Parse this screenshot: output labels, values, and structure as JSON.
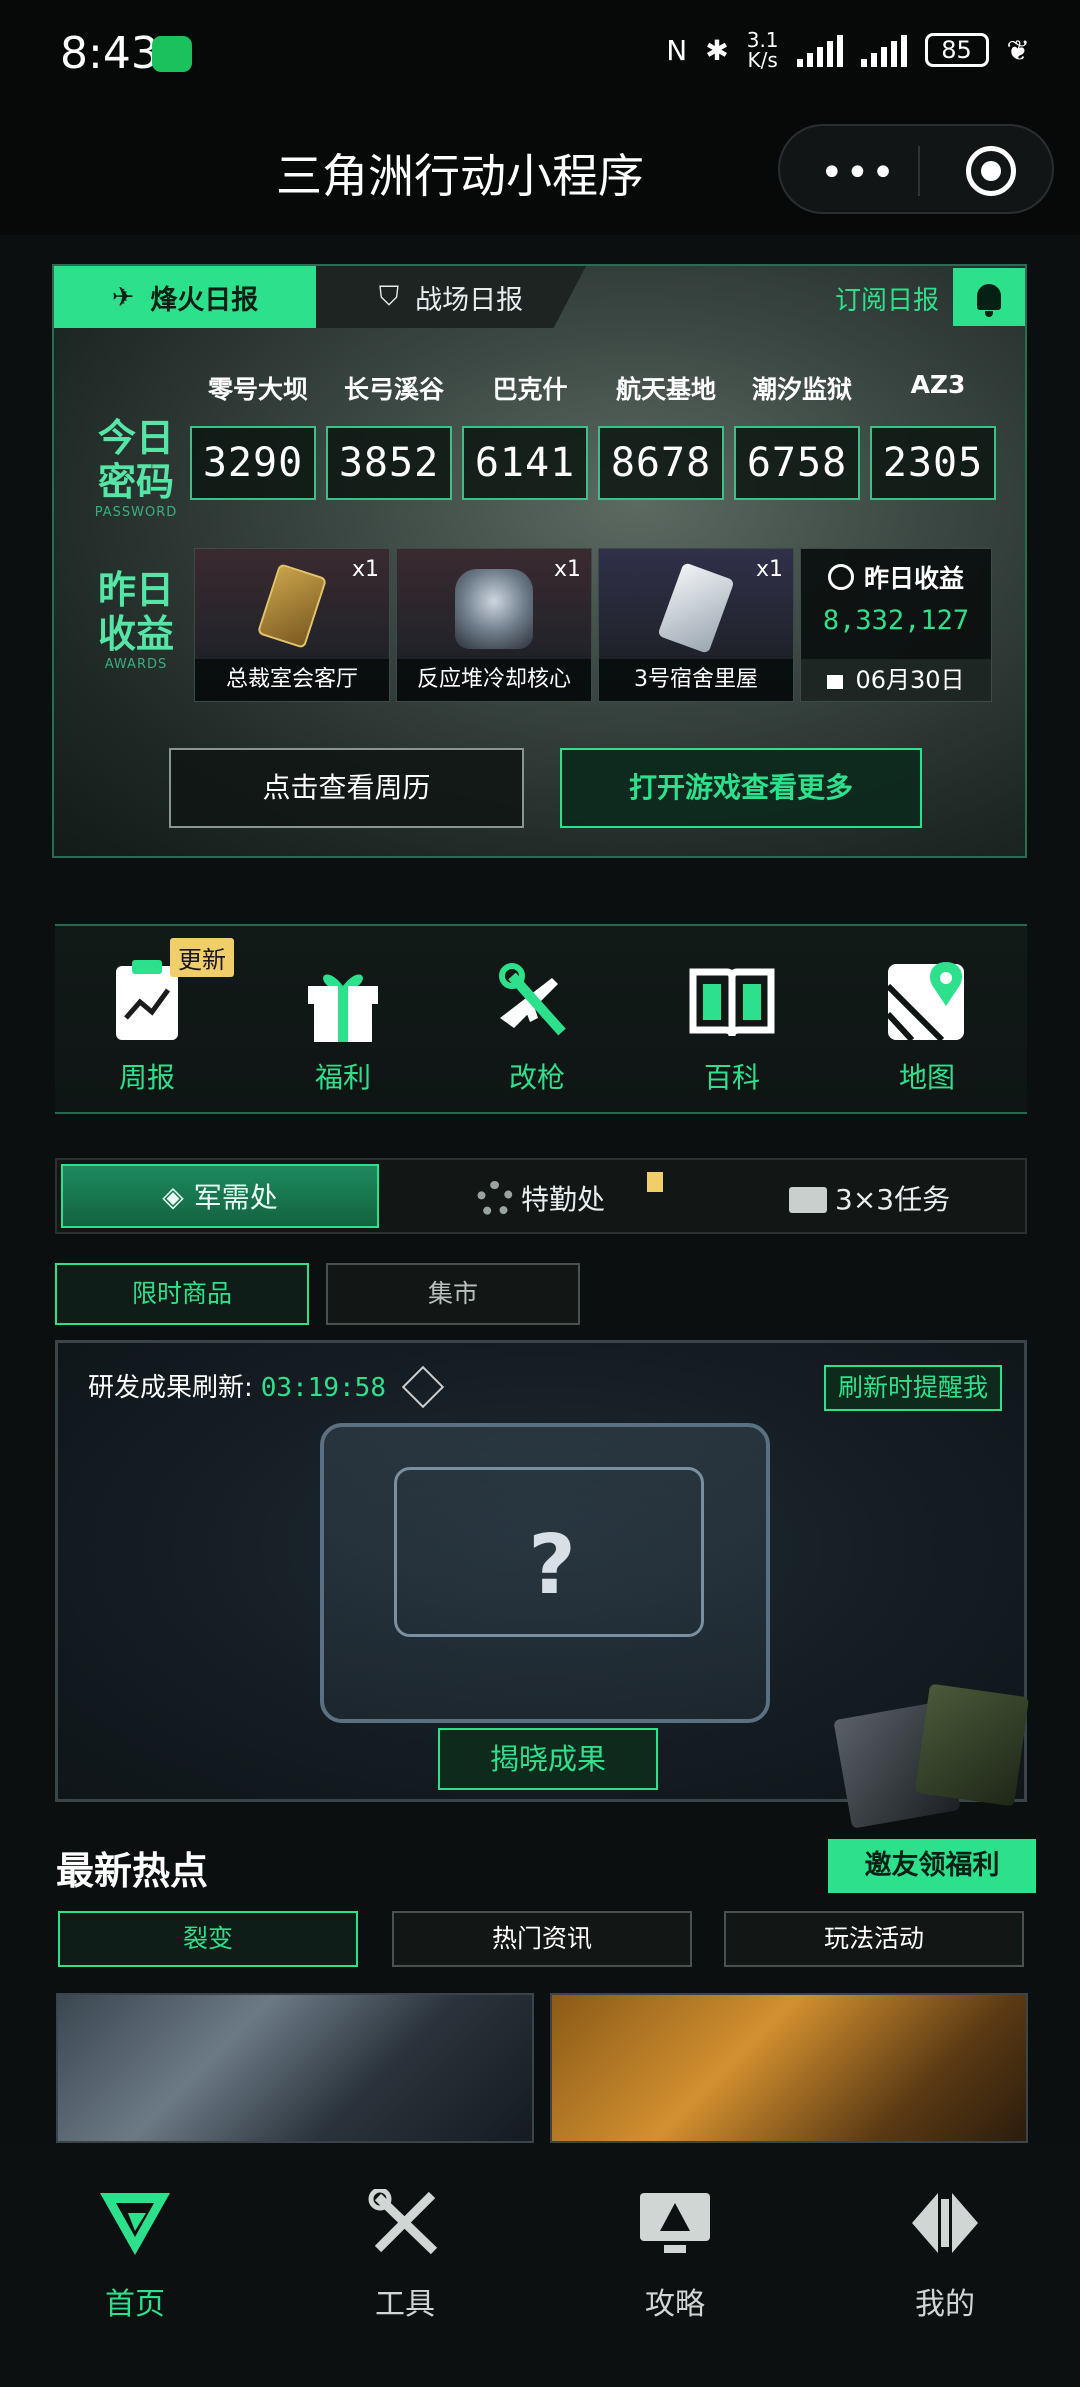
{
  "status_bar": {
    "time": "8:43",
    "net_speed_top": "3.1",
    "net_speed_bottom": "K/s",
    "battery": "85"
  },
  "title_bar": {
    "title": "三角洲行动小程序",
    "more_icon": "more-dots-icon",
    "close_icon": "target-icon"
  },
  "daily_report": {
    "tabs": [
      "烽火日报",
      "战场日报"
    ],
    "subscribe_label": "订阅日报",
    "password_label_line1": "今日",
    "password_label_line2": "密码",
    "password_label_en": "PASSWORD",
    "awards_label_line1": "昨日",
    "awards_label_line2": "收益",
    "awards_label_en": "AWARDS",
    "maps": [
      {
        "name": "零号大坝",
        "code": "3290"
      },
      {
        "name": "长弓溪谷",
        "code": "3852"
      },
      {
        "name": "巴克什",
        "code": "6141"
      },
      {
        "name": "航天基地",
        "code": "8678"
      },
      {
        "name": "潮汐监狱",
        "code": "6758"
      },
      {
        "name": "AZ3",
        "code": "2305"
      }
    ],
    "awards": [
      {
        "name": "总裁室会客厅",
        "qty": "x1"
      },
      {
        "name": "反应堆冷却核心",
        "qty": "x1"
      },
      {
        "name": "3号宿舍里屋",
        "qty": "x1"
      }
    ],
    "earnings": {
      "title": "昨日收益",
      "value": "8,332,127",
      "date": "06月30日"
    },
    "calendar_button": "点击查看周历",
    "open_game_button": "打开游戏查看更多"
  },
  "shortcuts": [
    {
      "label": "周报",
      "icon": "weekly-report-icon",
      "badge": "更新"
    },
    {
      "label": "福利",
      "icon": "gift-icon"
    },
    {
      "label": "改枪",
      "icon": "gun-mod-icon"
    },
    {
      "label": "百科",
      "icon": "book-icon"
    },
    {
      "label": "地图",
      "icon": "map-pin-icon"
    }
  ],
  "segments": [
    "军需处",
    "特勤处",
    "3×3任务"
  ],
  "shop_tabs": [
    "限时商品",
    "集市"
  ],
  "research": {
    "refresh_label": "研发成果刷新:",
    "timer": "03:19:58",
    "remind_button": "刷新时提醒我",
    "mystery": "?",
    "reveal_button": "揭晓成果"
  },
  "hot": {
    "title": "最新热点",
    "invite_button": "邀友领福利",
    "tabs": [
      "裂变",
      "热门资讯",
      "玩法活动"
    ]
  },
  "bottom_nav": [
    {
      "label": "首页",
      "icon": "home-logo-icon"
    },
    {
      "label": "工具",
      "icon": "tools-icon"
    },
    {
      "label": "攻略",
      "icon": "guide-monitor-icon"
    },
    {
      "label": "我的",
      "icon": "profile-icon"
    }
  ],
  "colors": {
    "accent": "#2de08c",
    "background": "#0b0f10",
    "badge": "#f0cf6a"
  }
}
